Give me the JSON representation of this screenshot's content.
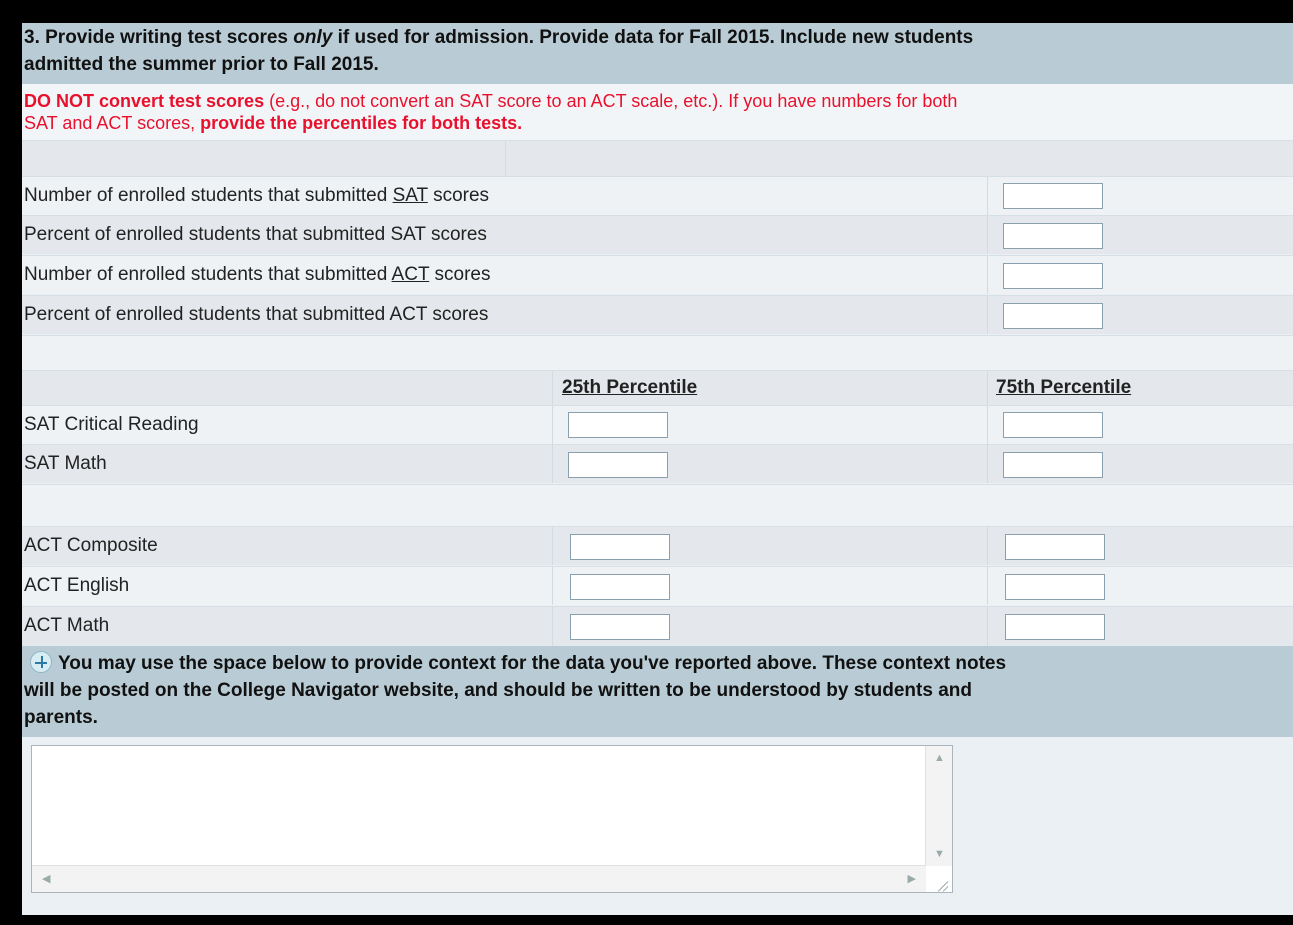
{
  "header": {
    "line1_pre": "3. Provide writing test scores ",
    "line1_em": "only",
    "line1_post": " if used for admission. Provide data for Fall 2015. Include new students",
    "line2": "admitted the summer prior to Fall 2015."
  },
  "warning": {
    "bold1": "DO NOT convert test scores",
    "text1": " (e.g., do not convert an SAT score to an ACT scale, etc.). If you have numbers for both",
    "text2": "SAT and ACT scores, ",
    "bold2": "provide the percentiles for both tests."
  },
  "submission_rows": [
    {
      "pre": "Number of enrolled students that submitted ",
      "u": "SAT",
      "post": " scores",
      "value": ""
    },
    {
      "pre": "Percent of enrolled students that submitted SAT scores",
      "u": "",
      "post": "",
      "value": ""
    },
    {
      "pre": "Number of enrolled students that submitted ",
      "u": "ACT",
      "post": " scores",
      "value": ""
    },
    {
      "pre": "Percent of enrolled students that submitted ACT scores",
      "u": "",
      "post": "",
      "value": ""
    }
  ],
  "percentile_headers": {
    "p25": "25th Percentile",
    "p75": "75th Percentile"
  },
  "sat_rows": [
    {
      "label": "SAT Critical Reading",
      "p25": "",
      "p75": ""
    },
    {
      "label": "SAT Math",
      "p25": "",
      "p75": ""
    }
  ],
  "act_rows": [
    {
      "label": "ACT Composite",
      "p25": "",
      "p75": ""
    },
    {
      "label": "ACT English",
      "p25": "",
      "p75": ""
    },
    {
      "label": "ACT Math",
      "p25": "",
      "p75": ""
    }
  ],
  "context_note": {
    "icon": "target-icon",
    "line1": "You may use the space below to provide context for the data you've reported above. These context notes",
    "line2": "will be posted on the College Navigator website, and should be written to be understood by students and",
    "line3": "parents.",
    "value": ""
  },
  "colors": {
    "header_bg": "#b9ccd5",
    "warning_text": "#e8112d",
    "frame_bg": "#000000"
  }
}
